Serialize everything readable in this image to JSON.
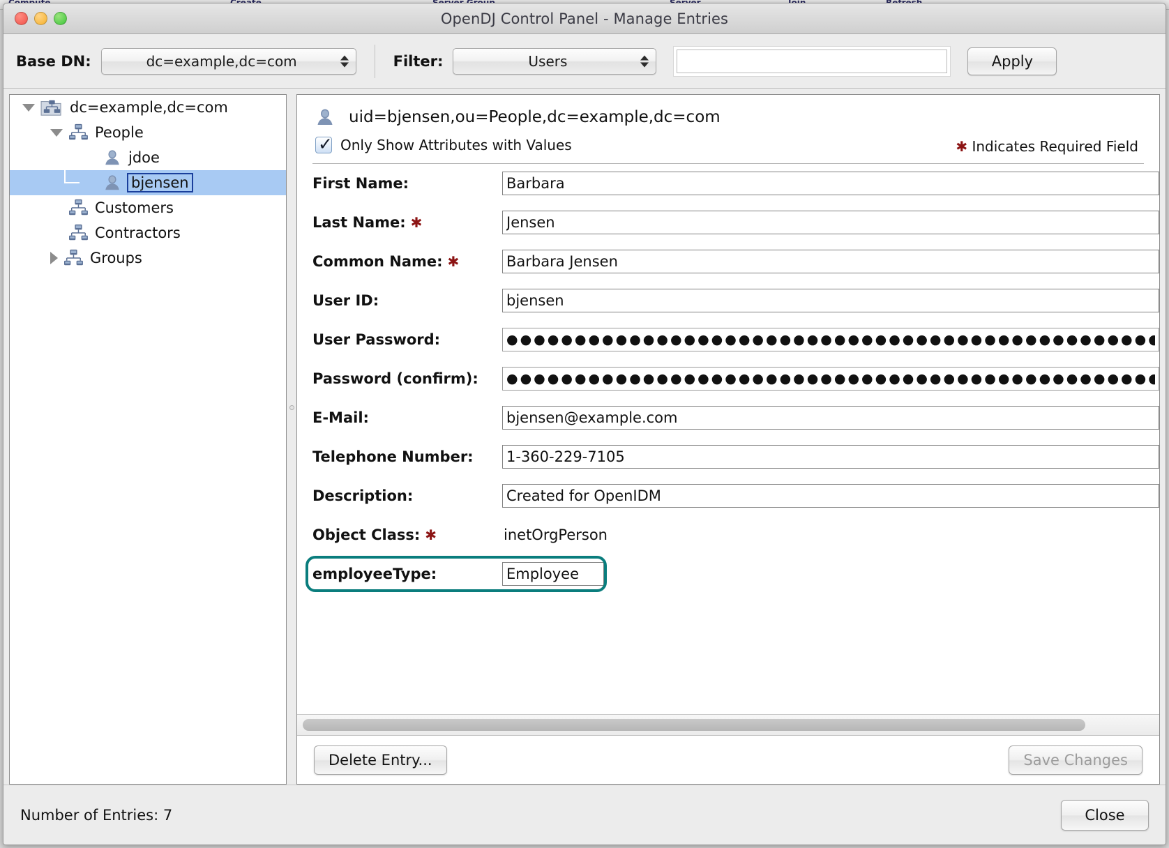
{
  "background": {
    "menu_items": [
      "Compute",
      "Create",
      "Server Group",
      "Server",
      "Join",
      "Refresh"
    ]
  },
  "window": {
    "title": "OpenDJ Control Panel - Manage Entries",
    "traffic_lights": [
      "close-icon",
      "minimize-icon",
      "zoom-icon"
    ]
  },
  "toolbar": {
    "base_dn_label": "Base DN:",
    "base_dn_value": "dc=example,dc=com",
    "filter_label": "Filter:",
    "filter_value": "Users",
    "search_value": "",
    "search_placeholder": "",
    "apply_label": "Apply"
  },
  "tree": [
    {
      "label": "dc=example,dc=com",
      "depth": 0,
      "twisty": "open",
      "icon": "database-folder-icon",
      "selected": false
    },
    {
      "label": "People",
      "depth": 1,
      "twisty": "open",
      "icon": "org-unit-icon",
      "selected": false
    },
    {
      "label": "jdoe",
      "depth": 2,
      "twisty": "none",
      "icon": "user-icon",
      "selected": false
    },
    {
      "label": "bjensen",
      "depth": 2,
      "twisty": "none",
      "icon": "user-icon",
      "selected": true
    },
    {
      "label": "Customers",
      "depth": 1,
      "twisty": "none",
      "icon": "org-unit-icon",
      "selected": false
    },
    {
      "label": "Contractors",
      "depth": 1,
      "twisty": "none",
      "icon": "org-unit-icon",
      "selected": false
    },
    {
      "label": "Groups",
      "depth": 1,
      "twisty": "closed",
      "icon": "org-unit-icon",
      "selected": false
    }
  ],
  "detail": {
    "entry_dn": "uid=bjensen,ou=People,dc=example,dc=com",
    "entry_icon": "user-icon",
    "only_show_label": "Only Show Attributes with Values",
    "only_show_checked": true,
    "required_note": "Indicates Required Field",
    "required_marker": "✱",
    "fields": [
      {
        "label": "First Name:",
        "value": "Barbara",
        "required": false,
        "type": "text"
      },
      {
        "label": "Last Name:",
        "value": "Jensen",
        "required": true,
        "type": "text"
      },
      {
        "label": "Common Name:",
        "value": "Barbara Jensen",
        "required": true,
        "type": "text"
      },
      {
        "label": "User ID:",
        "value": "bjensen",
        "required": false,
        "type": "text"
      },
      {
        "label": "User Password:",
        "value": "●●●●●●●●●●●●●●●●●●●●●●●●●●●●●●●●●●●●●●●●●●●●●●●●●●●●●●",
        "required": false,
        "type": "password"
      },
      {
        "label": "Password (confirm):",
        "value": "●●●●●●●●●●●●●●●●●●●●●●●●●●●●●●●●●●●●●●●●●●●●●●●●●●●●●●",
        "required": false,
        "type": "password"
      },
      {
        "label": "E-Mail:",
        "value": "bjensen@example.com",
        "required": false,
        "type": "text"
      },
      {
        "label": "Telephone Number:",
        "value": "1-360-229-7105",
        "required": false,
        "type": "text"
      },
      {
        "label": "Description:",
        "value": "Created for OpenIDM",
        "required": false,
        "type": "text"
      },
      {
        "label": "Object Class:",
        "value": "inetOrgPerson",
        "required": true,
        "type": "static"
      }
    ],
    "highlighted_field": {
      "label": "employeeType:",
      "value": "Employee",
      "highlight_color": "#0a7d7d"
    },
    "delete_label": "Delete Entry...",
    "save_label": "Save Changes",
    "save_enabled": false
  },
  "status": {
    "entries_text": "Number of Entries: 7",
    "close_label": "Close"
  }
}
